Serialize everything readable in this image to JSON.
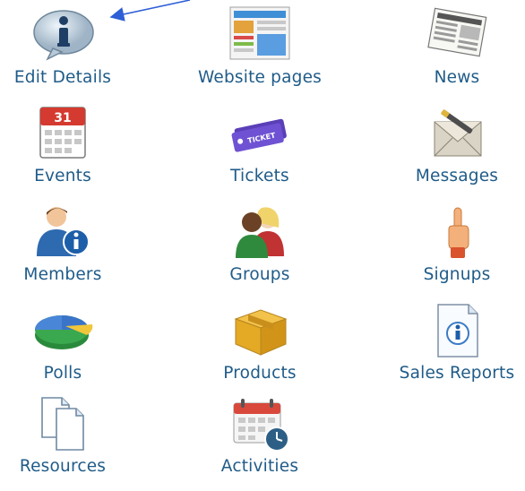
{
  "menu": {
    "items": [
      {
        "key": "edit-details",
        "label": "Edit Details",
        "icon": "info-bubble-icon"
      },
      {
        "key": "website-pages",
        "label": "Website pages",
        "icon": "layout-page-icon"
      },
      {
        "key": "news",
        "label": "News",
        "icon": "newspaper-icon"
      },
      {
        "key": "events",
        "label": "Events",
        "icon": "calendar-icon",
        "calendar_day": "31"
      },
      {
        "key": "tickets",
        "label": "Tickets",
        "icon": "ticket-icon",
        "ticket_text": "TICKET"
      },
      {
        "key": "messages",
        "label": "Messages",
        "icon": "envelope-icon"
      },
      {
        "key": "members",
        "label": "Members",
        "icon": "member-info-icon"
      },
      {
        "key": "groups",
        "label": "Groups",
        "icon": "people-group-icon"
      },
      {
        "key": "signups",
        "label": "Signups",
        "icon": "raised-hand-icon"
      },
      {
        "key": "polls",
        "label": "Polls",
        "icon": "pie-chart-icon"
      },
      {
        "key": "products",
        "label": "Products",
        "icon": "box-icon"
      },
      {
        "key": "sales-reports",
        "label": "Sales Reports",
        "icon": "info-document-icon"
      },
      {
        "key": "resources",
        "label": "Resources",
        "icon": "documents-icon"
      },
      {
        "key": "activities",
        "label": "Activities",
        "icon": "calendar-clock-icon"
      }
    ]
  },
  "colors": {
    "label_text": "#1f5b88",
    "arrow": "#2e5fd6"
  }
}
